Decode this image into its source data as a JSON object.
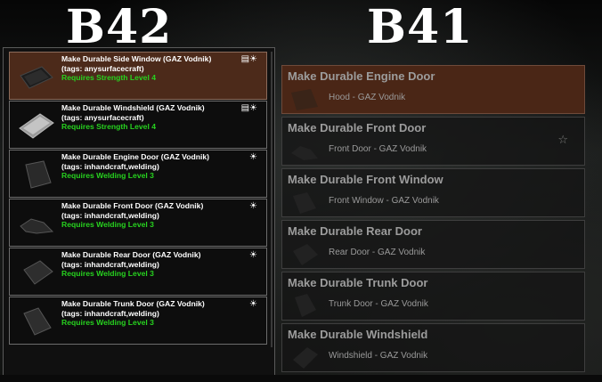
{
  "labels": {
    "left": "B42",
    "right": "B41"
  },
  "b42": {
    "items": [
      {
        "title": "Make Durable Side Window (GAZ Vodnik)",
        "tags": "(tags: anysurfacecraft)",
        "requirement": "Requires Strength Level 4",
        "icons": "bench-icon,sun-icon",
        "selected": true
      },
      {
        "title": "Make Durable Windshield (GAZ Vodnik)",
        "tags": "(tags: anysurfacecraft)",
        "requirement": "Requires Strength Level 4",
        "icons": "bench-icon,sun-icon",
        "selected": false
      },
      {
        "title": "Make Durable Engine Door (GAZ Vodnik)",
        "tags": "(tags: inhandcraft,welding)",
        "requirement": "Requires Welding Level 3",
        "icons": "sun-icon",
        "selected": false
      },
      {
        "title": "Make Durable Front Door (GAZ Vodnik)",
        "tags": "(tags: inhandcraft,welding)",
        "requirement": "Requires Welding Level 3",
        "icons": "sun-icon",
        "selected": false
      },
      {
        "title": "Make Durable Rear Door (GAZ Vodnik)",
        "tags": "(tags: inhandcraft,welding)",
        "requirement": "Requires Welding Level 3",
        "icons": "sun-icon",
        "selected": false
      },
      {
        "title": "Make Durable Trunk Door (GAZ Vodnik)",
        "tags": "(tags: inhandcraft,welding)",
        "requirement": "Requires Welding Level 3",
        "icons": "sun-icon",
        "selected": false
      }
    ]
  },
  "b41": {
    "items": [
      {
        "title": "Make Durable Engine Door",
        "subtitle": "Hood - GAZ Vodnik",
        "selected": true,
        "favorite": false
      },
      {
        "title": "Make Durable Front Door",
        "subtitle": "Front Door - GAZ Vodnik",
        "selected": false,
        "favorite": true
      },
      {
        "title": "Make Durable Front Window",
        "subtitle": "Front Window - GAZ Vodnik",
        "selected": false,
        "favorite": false
      },
      {
        "title": "Make Durable Rear Door",
        "subtitle": "Rear Door - GAZ Vodnik",
        "selected": false,
        "favorite": false
      },
      {
        "title": "Make Durable Trunk Door",
        "subtitle": "Trunk Door - GAZ Vodnik",
        "selected": false,
        "favorite": false
      },
      {
        "title": "Make Durable Windshield",
        "subtitle": "Windshield - GAZ Vodnik",
        "selected": false,
        "favorite": false
      }
    ]
  },
  "colors": {
    "selected_row": "#4c2a1a",
    "requirement_text": "#27d21f",
    "b41_text": "#9c9c9c"
  }
}
